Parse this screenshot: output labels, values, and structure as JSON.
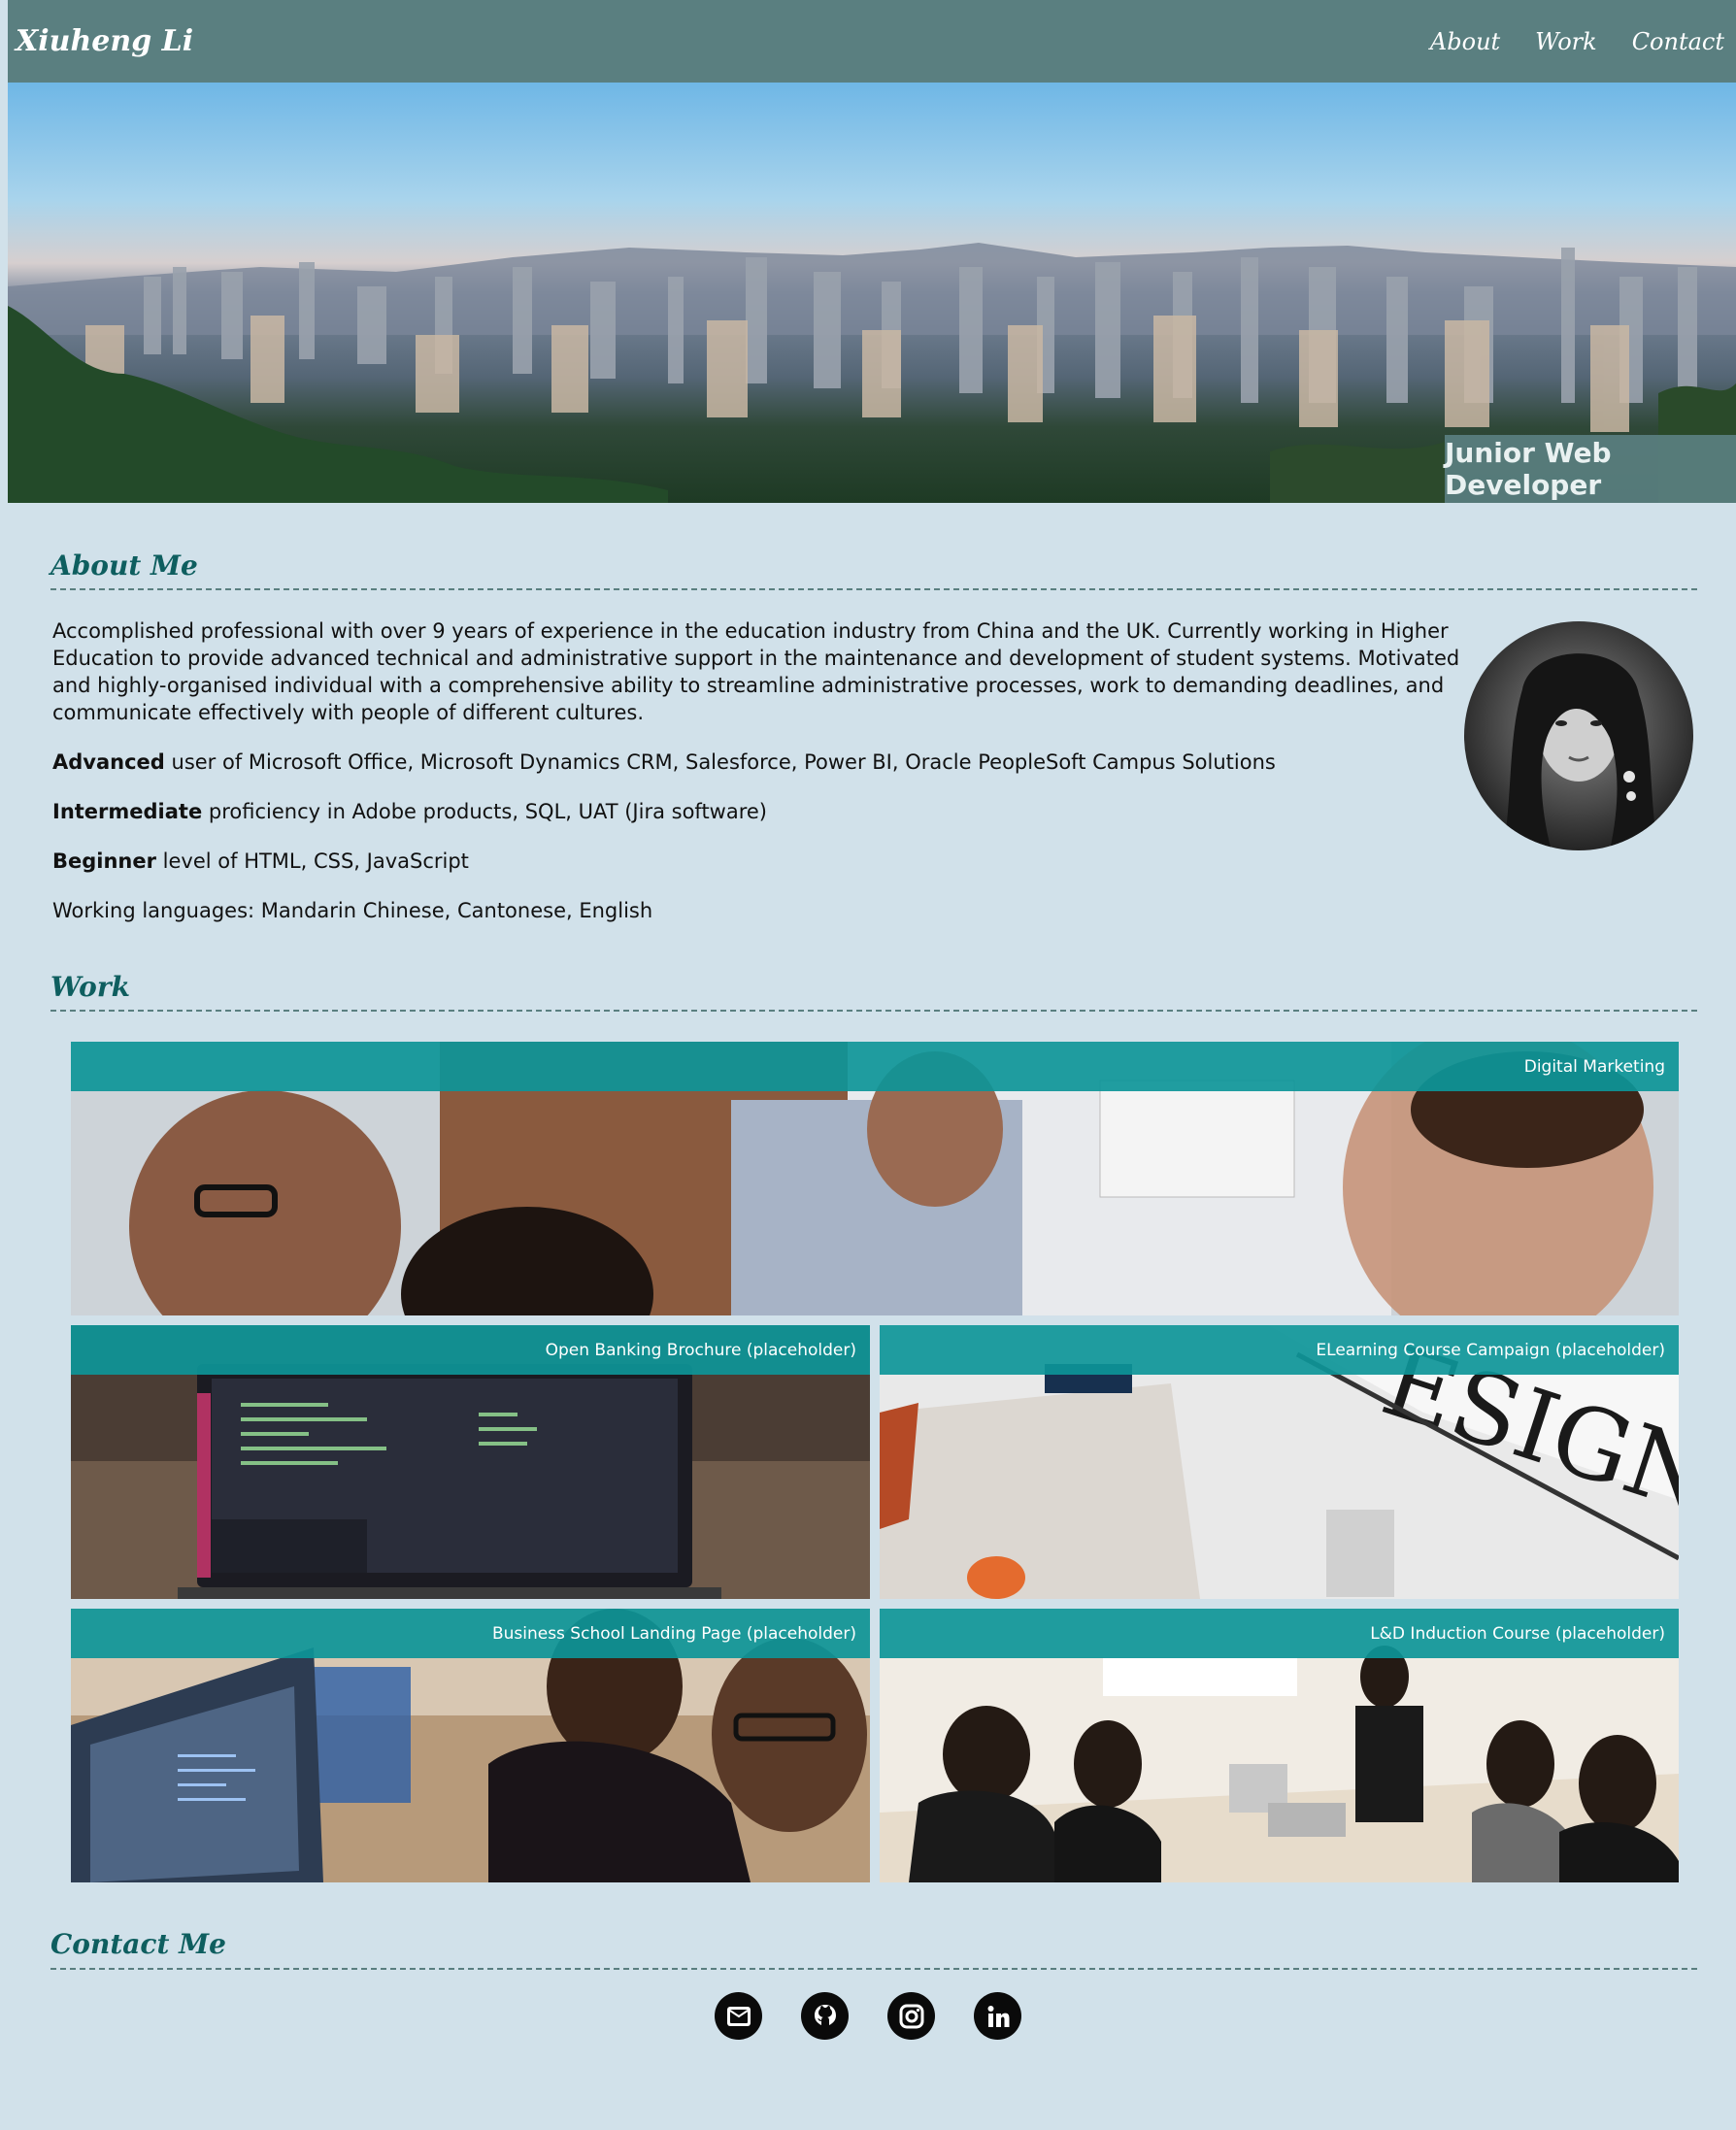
{
  "nav": {
    "brand": "Xiuheng Li",
    "links": [
      "About",
      "Work",
      "Contact"
    ]
  },
  "hero": {
    "badge": "Junior Web Developer"
  },
  "about": {
    "heading": "About Me",
    "intro": "Accomplished professional with over 9 years of experience in the education industry from China and the UK. Currently working in Higher Education to provide advanced technical and administrative support in the maintenance and development of student systems. Motivated and highly-organised individual with a comprehensive ability to streamline administrative processes, work to demanding deadlines, and communicate effectively with people of different cultures.",
    "skills": [
      {
        "level": "Advanced",
        "rest": " user of Microsoft Office, Microsoft Dynamics CRM, Salesforce, Power BI, Oracle PeopleSoft Campus Solutions"
      },
      {
        "level": "Intermediate",
        "rest": " proficiency in Adobe products, SQL, UAT (Jira software)"
      },
      {
        "level": "Beginner",
        "rest": " level of HTML, CSS, JavaScript"
      }
    ],
    "languages": "Working languages: Mandarin Chinese, Cantonese, English"
  },
  "work": {
    "heading": "Work",
    "projects": [
      {
        "title": "Digital Marketing"
      },
      {
        "title": "Open Banking Brochure (placeholder)"
      },
      {
        "title": "ELearning Course Campaign (placeholder)"
      },
      {
        "title": "Business School Landing Page (placeholder)"
      },
      {
        "title": "L&D Induction Course (placeholder)"
      }
    ]
  },
  "contact": {
    "heading": "Contact Me",
    "icons": [
      "email-icon",
      "github-icon",
      "instagram-icon",
      "linkedin-icon"
    ]
  },
  "colors": {
    "nav_bg": "#5a7f80",
    "page_bg": "#d1e1ea",
    "heading": "#0e5e5f",
    "card_band": "#0d9598"
  }
}
